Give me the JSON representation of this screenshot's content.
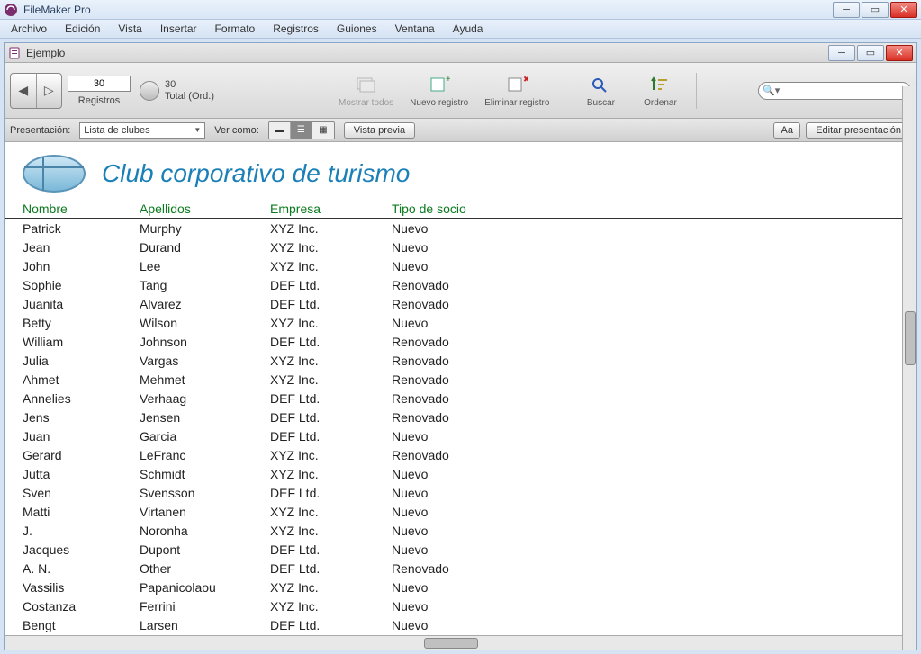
{
  "app": {
    "title": "FileMaker Pro"
  },
  "menu": [
    "Archivo",
    "Edición",
    "Vista",
    "Insertar",
    "Formato",
    "Registros",
    "Guiones",
    "Ventana",
    "Ayuda"
  ],
  "subwin": {
    "title": "Ejemplo"
  },
  "toolbar": {
    "record_current": "30",
    "records_label": "Registros",
    "total_count": "30",
    "total_label": "Total (Ord.)",
    "show_all": "Mostrar todos",
    "new_record": "Nuevo registro",
    "delete_record": "Eliminar registro",
    "find": "Buscar",
    "sort": "Ordenar"
  },
  "toolbar2": {
    "layout_label": "Presentación:",
    "layout_value": "Lista de clubes",
    "view_as_label": "Ver como:",
    "preview": "Vista previa",
    "font_btn": "Aa",
    "edit_layout": "Editar presentación"
  },
  "page": {
    "title": "Club corporativo de turismo",
    "columns": [
      "Nombre",
      "Apellidos",
      "Empresa",
      "Tipo de socio"
    ],
    "rows": [
      [
        "Patrick",
        "Murphy",
        "XYZ Inc.",
        "Nuevo"
      ],
      [
        "Jean",
        "Durand",
        "XYZ Inc.",
        "Nuevo"
      ],
      [
        "John",
        "Lee",
        "XYZ Inc.",
        "Nuevo"
      ],
      [
        "Sophie",
        "Tang",
        "DEF Ltd.",
        "Renovado"
      ],
      [
        "Juanita",
        "Alvarez",
        "DEF Ltd.",
        "Renovado"
      ],
      [
        "Betty",
        "Wilson",
        "XYZ Inc.",
        "Nuevo"
      ],
      [
        "William",
        "Johnson",
        "DEF Ltd.",
        "Renovado"
      ],
      [
        "Julia",
        "Vargas",
        "XYZ Inc.",
        "Renovado"
      ],
      [
        "Ahmet",
        "Mehmet",
        "XYZ Inc.",
        "Renovado"
      ],
      [
        "Annelies",
        "Verhaag",
        "DEF Ltd.",
        "Renovado"
      ],
      [
        "Jens",
        "Jensen",
        "DEF Ltd.",
        "Renovado"
      ],
      [
        "Juan",
        "Garcia",
        "DEF Ltd.",
        "Nuevo"
      ],
      [
        "Gerard",
        "LeFranc",
        "XYZ Inc.",
        "Renovado"
      ],
      [
        "Jutta",
        "Schmidt",
        "XYZ Inc.",
        "Nuevo"
      ],
      [
        "Sven",
        "Svensson",
        "DEF Ltd.",
        "Nuevo"
      ],
      [
        "Matti",
        "Virtanen",
        "XYZ Inc.",
        "Nuevo"
      ],
      [
        "J.",
        "Noronha",
        "XYZ Inc.",
        "Nuevo"
      ],
      [
        "Jacques",
        "Dupont",
        "DEF Ltd.",
        "Nuevo"
      ],
      [
        "A. N.",
        "Other",
        "DEF Ltd.",
        "Renovado"
      ],
      [
        "Vassilis",
        "Papanicolaou",
        "XYZ Inc.",
        "Nuevo"
      ],
      [
        "Costanza",
        "Ferrini",
        "XYZ Inc.",
        "Nuevo"
      ],
      [
        "Bengt",
        "Larsen",
        "DEF Ltd.",
        "Nuevo"
      ]
    ]
  }
}
